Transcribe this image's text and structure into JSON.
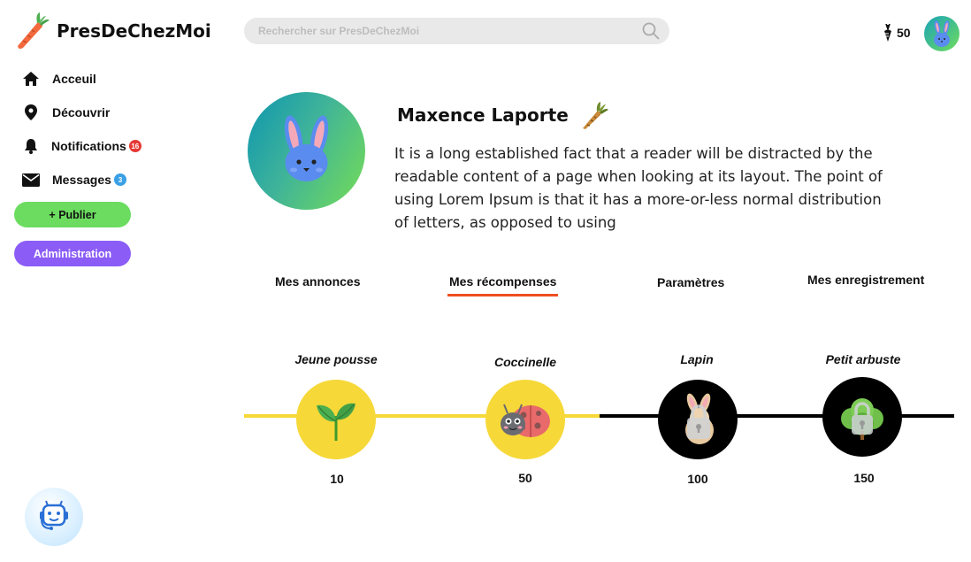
{
  "app": {
    "name": "PresDeChezMoi"
  },
  "sidebar": {
    "items": [
      {
        "label": "Acceuil",
        "icon": "home-icon"
      },
      {
        "label": "Découvrir",
        "icon": "location-pin-icon"
      },
      {
        "label": "Notifications",
        "icon": "bell-icon",
        "badge": "16"
      },
      {
        "label": "Messages",
        "icon": "envelope-icon",
        "badge": "3"
      }
    ],
    "publish_label": "+ Publier",
    "admin_label": "Administration"
  },
  "search": {
    "placeholder": "Rechercher sur PresDeChezMoi"
  },
  "header": {
    "points": "50"
  },
  "profile": {
    "name": "Maxence Laporte",
    "bio": "It is a long established fact that a reader will be distracted by the readable content of a page when looking at its layout. The point of using Lorem Ipsum is that it has a more-or-less normal distribution of letters, as opposed to using"
  },
  "tabs": [
    {
      "label": "Mes annonces",
      "active": false
    },
    {
      "label": "Mes récompenses",
      "active": true
    },
    {
      "label": "Paramètres",
      "active": false
    },
    {
      "label": "Mes enregistrement",
      "active": false
    }
  ],
  "rewards": [
    {
      "name": "Jeune pousse",
      "points": "10",
      "unlocked": true,
      "icon": "sprout-icon"
    },
    {
      "name": "Coccinelle",
      "points": "50",
      "unlocked": true,
      "icon": "ladybug-icon"
    },
    {
      "name": "Lapin",
      "points": "100",
      "unlocked": false,
      "icon": "rabbit-icon"
    },
    {
      "name": "Petit arbuste",
      "points": "150",
      "unlocked": false,
      "icon": "shrub-icon"
    }
  ],
  "colors": {
    "accent_green": "#6bdc5f",
    "accent_purple": "#8b5cf6",
    "tab_underline": "#f04e23",
    "reward_unlocked": "#f6d838",
    "reward_locked": "#000000"
  }
}
